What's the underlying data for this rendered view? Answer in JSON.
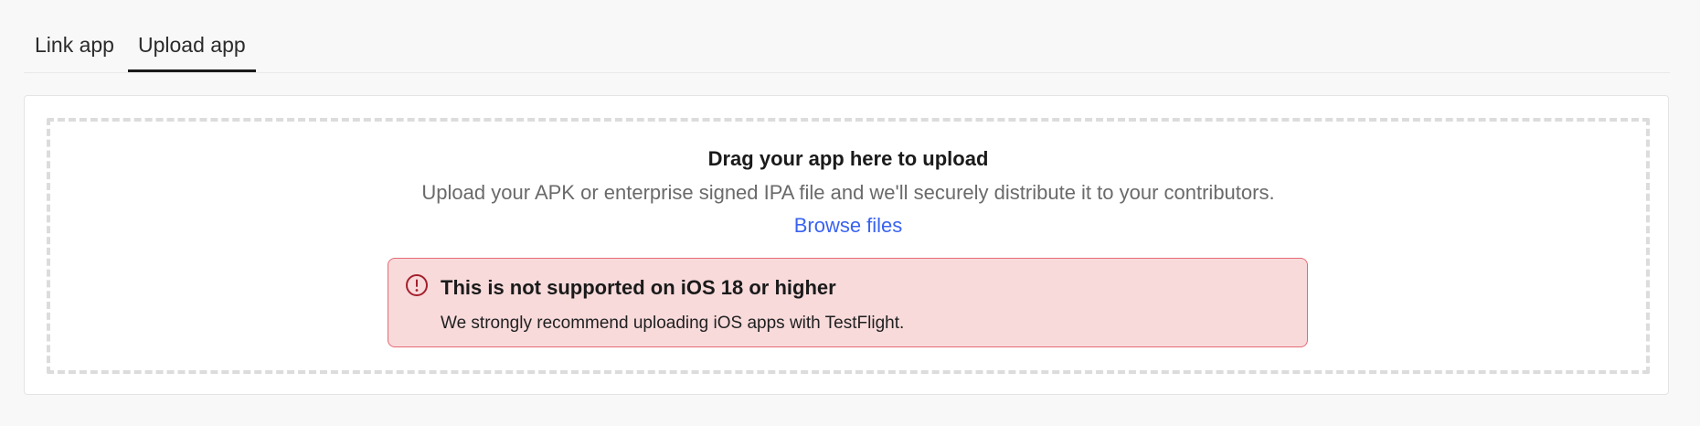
{
  "tabs": [
    {
      "label": "Link app",
      "active": false
    },
    {
      "label": "Upload app",
      "active": true
    }
  ],
  "upload": {
    "title": "Drag your app here to upload",
    "subtitle": "Upload your APK or enterprise signed IPA file and we'll securely distribute it to your contributors.",
    "browse_label": "Browse files"
  },
  "alert": {
    "icon": "exclamation-circle-icon",
    "title": "This is not supported on iOS 18 or higher",
    "body": "We strongly recommend uploading iOS apps with TestFlight."
  },
  "colors": {
    "link": "#3a63f0",
    "alert_bg": "#f8dadb",
    "alert_border": "#e56b73",
    "alert_icon": "#a3202c"
  }
}
